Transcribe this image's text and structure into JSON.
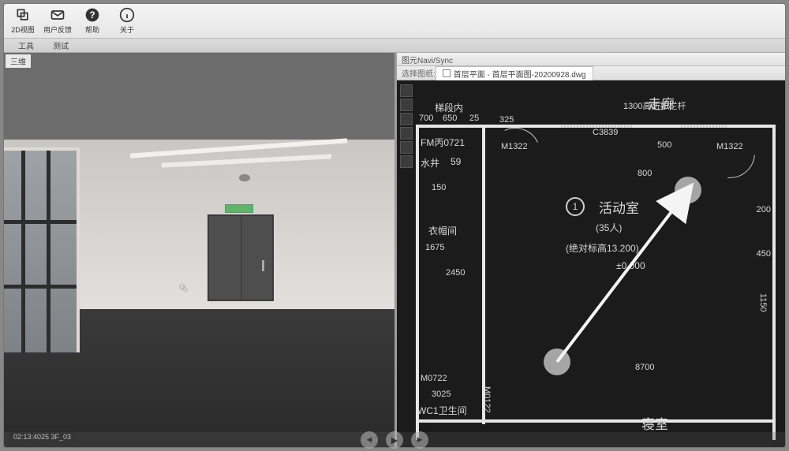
{
  "toolbar": {
    "items": [
      {
        "name": "view3d-button",
        "icon": "layers",
        "label": "2D视图"
      },
      {
        "name": "feedback-button",
        "icon": "mail",
        "label": "用户反馈"
      },
      {
        "name": "help-button",
        "icon": "help",
        "label": "帮助"
      },
      {
        "name": "about-button",
        "icon": "info",
        "label": "关于"
      }
    ]
  },
  "subtabs": {
    "left": "工具",
    "right": "测试"
  },
  "view3d": {
    "status": "02:13:4025  3F_03",
    "tab": "三维"
  },
  "cad": {
    "window_title": "图元Navi/Sync",
    "tab_prefix": "选择图纸:",
    "tab_label": "首层平面 - 首层平面图-20200928.dwg",
    "rooms": {
      "corridor": "走廊",
      "stair_section": "梯段内",
      "cloakroom": "衣帽间",
      "activity_number": "1",
      "activity": "活动室",
      "activity_cap": "(35人)",
      "activity_elev": "(绝对标高13.200)",
      "activity_pm": "±0.000",
      "water": "水井",
      "fm": "FM丙0721",
      "wc": "WC1卫生间",
      "bedroom": "寝室",
      "rail": "1300高防护栏杆"
    },
    "labels": {
      "M1322_a": "M1322",
      "M1322_b": "M1322",
      "C3839": "C3839",
      "M0722": "M0722",
      "M0122": "M0122",
      "num59": "59"
    },
    "dims": {
      "d700": "700",
      "d650": "650",
      "d325": "325",
      "d25": "25",
      "d800": "800",
      "d500": "500",
      "d1675": "1675",
      "d2450": "2450",
      "d1150": "1150",
      "d8700": "8700",
      "d3025": "3025",
      "d200": "200",
      "d150": "150",
      "d450": "450"
    }
  },
  "playbar": {
    "prev": "◄",
    "play": "▶",
    "next": "►"
  }
}
